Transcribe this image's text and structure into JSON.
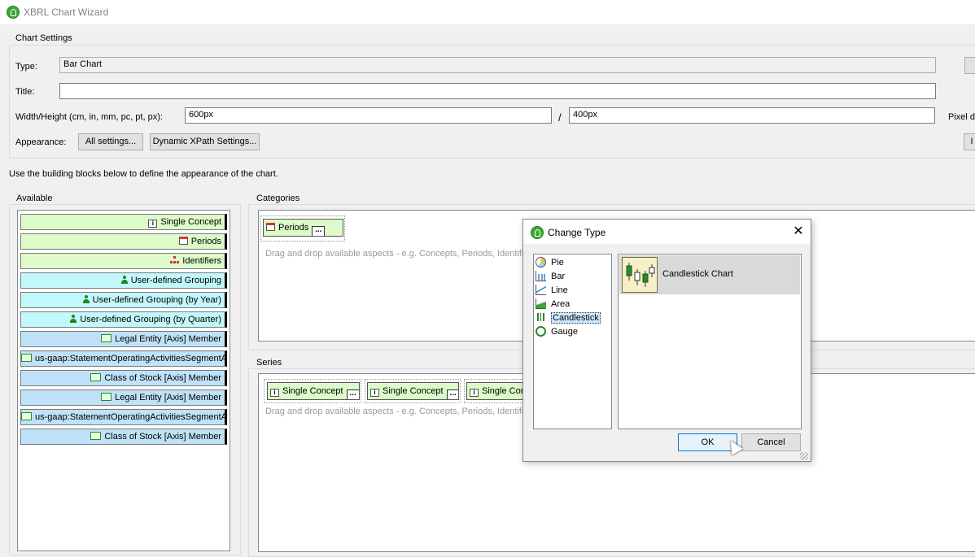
{
  "window": {
    "title": "XBRL Chart Wizard"
  },
  "settings": {
    "group_label": "Chart Settings",
    "type_label": "Type:",
    "type_value": "Bar Chart",
    "title_label": "Title:",
    "title_value": "",
    "size_label": "Width/Height (cm, in, mm, pc, pt, px):",
    "width_value": "600px",
    "height_value": "400px",
    "separator": "/",
    "pixel_label": "Pixel de",
    "appearance_label": "Appearance:",
    "all_settings_button": "All settings...",
    "xpath_button": "Dynamic XPath Settings...",
    "right_button": "I"
  },
  "instructions": "Use the building blocks below to define the appearance of the chart.",
  "available": {
    "label": "Available",
    "items": [
      {
        "label": "Single Concept",
        "icon": "concept-icon",
        "color": "green"
      },
      {
        "label": "Periods",
        "icon": "calendar-icon",
        "color": "green"
      },
      {
        "label": "Identifiers",
        "icon": "hierarchy-icon",
        "color": "green"
      },
      {
        "label": "User-defined Grouping",
        "icon": "person-icon",
        "color": "cyan"
      },
      {
        "label": "User-defined Grouping (by Year)",
        "icon": "person-icon",
        "color": "cyan"
      },
      {
        "label": "User-defined Grouping (by Quarter)",
        "icon": "person-icon",
        "color": "cyan"
      },
      {
        "label": "Legal Entity [Axis] Member",
        "icon": "axis-icon",
        "color": "blue"
      },
      {
        "label": "us-gaap:StatementOperatingActivitiesSegmentA",
        "icon": "axis-icon",
        "color": "blue"
      },
      {
        "label": "Class of Stock [Axis] Member",
        "icon": "axis-icon",
        "color": "blue"
      },
      {
        "label": "Legal Entity [Axis] Member",
        "icon": "axis-icon",
        "color": "blue"
      },
      {
        "label": "us-gaap:StatementOperatingActivitiesSegmentA",
        "icon": "axis-icon",
        "color": "blue"
      },
      {
        "label": "Class of Stock [Axis] Member",
        "icon": "axis-icon",
        "color": "blue"
      }
    ]
  },
  "categories": {
    "label": "Categories",
    "chip": "Periods",
    "hint": "Drag and drop available aspects - e.g. Concepts, Periods, Identifie"
  },
  "series": {
    "label": "Series",
    "chips": [
      "Single Concept",
      "Single Concept",
      "Single Cor"
    ],
    "hint": "Drag and drop available aspects - e.g. Concepts, Periods, Identifie"
  },
  "dialog": {
    "title": "Change Type",
    "types": [
      {
        "label": "Pie",
        "icon": "pie-icon"
      },
      {
        "label": "Bar",
        "icon": "bar-icon"
      },
      {
        "label": "Line",
        "icon": "line-icon"
      },
      {
        "label": "Area",
        "icon": "area-icon"
      },
      {
        "label": "Candlestick",
        "icon": "candlestick-icon",
        "selected": true
      },
      {
        "label": "Gauge",
        "icon": "gauge-icon"
      }
    ],
    "chart_item": "Candlestick Chart",
    "ok": "OK",
    "cancel": "Cancel"
  },
  "colors": {
    "green": "#dcfbc8",
    "cyan": "#c2f7fb",
    "blue": "#bfe2f8",
    "accent": "#0078d7"
  }
}
